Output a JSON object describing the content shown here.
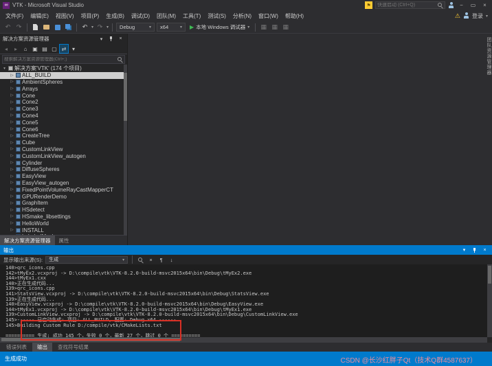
{
  "titlebar": {
    "app_title": "VTK - Microsoft Visual Studio",
    "quick_launch_placeholder": "快速启动 (Ctrl+Q)"
  },
  "menubar": {
    "items": [
      "文件(F)",
      "编辑(E)",
      "视图(V)",
      "项目(P)",
      "生成(B)",
      "调试(D)",
      "团队(M)",
      "工具(T)",
      "测试(S)",
      "分析(N)",
      "窗口(W)",
      "帮助(H)"
    ],
    "user_name": "登录"
  },
  "toolbar": {
    "configuration": "Debug",
    "platform": "x64",
    "debug_target": "本地 Windows 调试器"
  },
  "solution_explorer": {
    "title": "解决方案资源管理器",
    "search_placeholder": "搜索解决方案资源管理器(Ctrl+;)",
    "solution_label": "解决方案'VTK' (174 个项目)",
    "projects": [
      {
        "label": "ALL_BUILD",
        "selected": true
      },
      {
        "label": "AmbientSpheres"
      },
      {
        "label": "Arrays"
      },
      {
        "label": "Cone"
      },
      {
        "label": "Cone2"
      },
      {
        "label": "Cone3"
      },
      {
        "label": "Cone4"
      },
      {
        "label": "Cone5"
      },
      {
        "label": "Cone6"
      },
      {
        "label": "CreateTree"
      },
      {
        "label": "Cube"
      },
      {
        "label": "CustomLinkView"
      },
      {
        "label": "CustomLinkView_autogen"
      },
      {
        "label": "Cylinder"
      },
      {
        "label": "DiffuseSpheres"
      },
      {
        "label": "EasyView"
      },
      {
        "label": "EasyView_autogen"
      },
      {
        "label": "FixedPointVolumeRayCastMapperCT"
      },
      {
        "label": "GPURenderDemo"
      },
      {
        "label": "GraphItem"
      },
      {
        "label": "HSdetect"
      },
      {
        "label": "HSmake_libsettings"
      },
      {
        "label": "HelloWorld"
      },
      {
        "label": "INSTALL"
      },
      {
        "label": "LabeledMesh"
      }
    ],
    "bottom_tabs": [
      {
        "label": "解决方案资源管理器",
        "active": true
      },
      {
        "label": "属性"
      }
    ]
  },
  "right_strip": {
    "tab_label": "团队资源管理器"
  },
  "output_panel": {
    "title": "输出",
    "source_label": "显示输出来源(S):",
    "source_value": "生成",
    "lines": [
      "140>qrc_icons.cpp",
      "142>tMyEx2.vcxproj -> D:\\compile\\vtk\\VTK-8.2.0-build-msvc2015x64\\bin\\Debug\\tMyEx2.exe",
      "144>tMyEx1.cxx",
      "140>正在生成代码...",
      "139>qrc_icons.cpp",
      "141>StatsView.vcxproj -> D:\\compile\\vtk\\VTK-8.2.0-build-msvc2015x64\\bin\\Debug\\StatsView.exe",
      "139>正在生成代码...",
      "140>EasyView.vcxproj -> D:\\compile\\vtk\\VTK-8.2.0-build-msvc2015x64\\bin\\Debug\\EasyView.exe",
      "144>tMyEx1.vcxproj -> D:\\compile\\vtk\\VTK-8.2.0-build-msvc2015x64\\bin\\Debug\\tMyEx1.exe",
      "139>CustomLinkView.vcxproj -> D:\\compile\\vtk\\VTK-8.2.0-build-msvc2015x64\\bin\\Debug\\CustomLinkView.exe",
      "145>------ 已启动生成: 项目: ALL_BUILD, 配置: Debug x64 ------",
      "145>Building Custom Rule D:/compile/vtk/CMakeLists.txt",
      "",
      "========== 生成: 成功 145 个，失败 0 个，最新 27 个，跳过 0 个 =========="
    ]
  },
  "panel_tabs": [
    {
      "label": "错误列表"
    },
    {
      "label": "输出",
      "active": true
    },
    {
      "label": "查找符号结果"
    }
  ],
  "statusbar": {
    "text": "生成成功"
  },
  "watermark": {
    "text": "CSDN @长沙红胖子Qt（技术Q群4587637）"
  },
  "colors": {
    "accent": "#007acc",
    "chrome": "#2d2d30",
    "panel": "#252526",
    "console_bg": "#1e1e1e",
    "selection": "#cfcfcf",
    "annotation_red": "#d93025",
    "watermark_pink": "#ee8f9c",
    "flag_yellow": "#ffcc33",
    "play_green": "#3fba54"
  },
  "icons": {
    "infinity": "∞",
    "flag": "⚑",
    "warning": "⚠",
    "minimize": "−",
    "maximize": "▭",
    "close": "×",
    "chevron_down": "▾",
    "nav_back": "↶",
    "nav_forward": "↷",
    "undo": "↶",
    "redo": "↷",
    "play": "▶",
    "expander_collapsed": "▷",
    "expander_expanded": "▾",
    "home": "⌂",
    "back_small": "◂",
    "forward_small": "▸",
    "collapse_all": "▣",
    "properties": "▤",
    "show_all_files": "▢",
    "sync": "⇄",
    "word_wrap": "¶",
    "autoscroll": "↓",
    "clear_all": "×",
    "grid": "▦"
  }
}
